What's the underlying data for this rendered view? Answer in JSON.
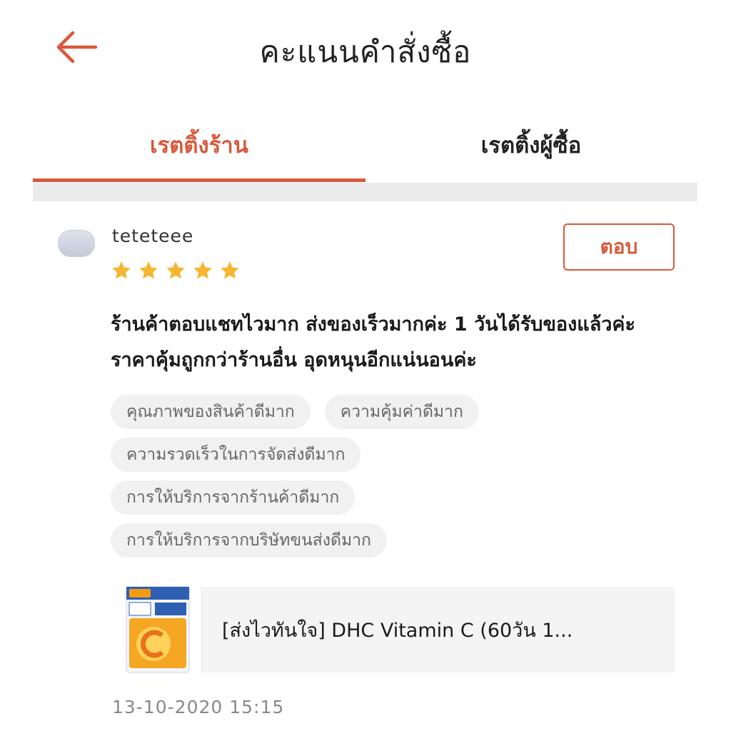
{
  "header": {
    "title": "คะแนนคำสั่งซื้อ",
    "back_icon": "arrow-left-icon"
  },
  "tabs": [
    {
      "label": "เรตติ้งร้าน",
      "active": true
    },
    {
      "label": "เรตติ้งผู้ซื้อ",
      "active": false
    }
  ],
  "review": {
    "username": "teteteee",
    "rating": 5,
    "reply_label": "ตอบ",
    "text": "ร้านค้าตอบแชทไวมาก ส่งของเร็วมากค่ะ 1 วันได้รับของแล้วค่ะ ราคาคุ้มถูกกว่าร้านอื่น อุดหนุนอีกแน่นอนค่ะ",
    "tags": [
      [
        "คุณภาพของสินค้าดีมาก",
        "ความคุ้มค่าดีมาก"
      ],
      [
        "ความรวดเร็วในการจัดส่งดีมาก"
      ],
      [
        "การให้บริการจากร้านค้าดีมาก"
      ],
      [
        "การให้บริการจากบริษัทขนส่งดีมาก"
      ]
    ],
    "product": {
      "name": "[ส่งไวทันใจ] DHC Vitamin C (60วัน 1..."
    },
    "timestamp": "13-10-2020 15:15"
  },
  "colors": {
    "accent": "#d9593b",
    "star": "#f5b731",
    "tag_bg": "#f1f1f1"
  }
}
